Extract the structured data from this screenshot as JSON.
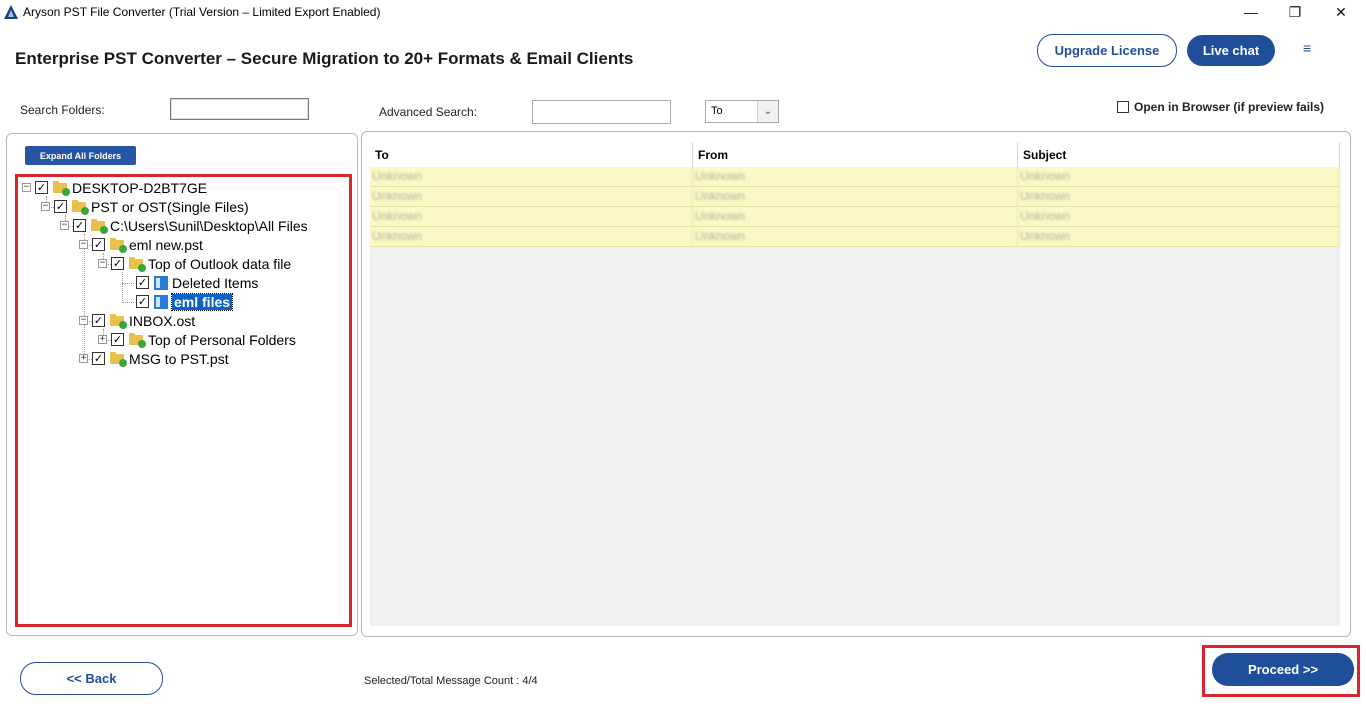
{
  "window": {
    "title": "Aryson PST File Converter (Trial Version – Limited Export Enabled)",
    "controls": {
      "minimize": "—",
      "restore": "❐",
      "close": "✕"
    }
  },
  "header": {
    "heading": "Enterprise PST Converter – Secure Migration to 20+ Formats & Email Clients",
    "upgrade_label": "Upgrade License",
    "livechat_label": "Live chat",
    "menu_icon": "≡"
  },
  "search": {
    "folders_label": "Search Folders:",
    "folders_value": "",
    "advanced_label": "Advanced Search:",
    "advanced_value": "",
    "field_select": "To",
    "open_browser_label": "Open in Browser (if preview fails)"
  },
  "tree": {
    "expand_all_label": "Expand All Folders",
    "nodes": [
      {
        "label": "DESKTOP-D2BT7GE",
        "expander": "−",
        "checked": true,
        "icon": "folder-icon"
      },
      {
        "label": "PST or OST(Single Files)",
        "expander": "−",
        "checked": true,
        "icon": "folder-icon"
      },
      {
        "label": "C:\\Users\\Sunil\\Desktop\\All Files",
        "expander": "−",
        "checked": true,
        "icon": "folder-icon"
      },
      {
        "label": "eml new.pst",
        "expander": "−",
        "checked": true,
        "icon": "folder-icon"
      },
      {
        "label": "Top of Outlook data file",
        "expander": "−",
        "checked": true,
        "icon": "folder-icon"
      },
      {
        "label": "Deleted Items",
        "expander": "",
        "checked": true,
        "icon": "mail-folder-icon"
      },
      {
        "label": "eml files",
        "expander": "",
        "checked": true,
        "icon": "mail-folder-icon",
        "selected": true
      },
      {
        "label": "INBOX.ost",
        "expander": "−",
        "checked": true,
        "icon": "folder-icon"
      },
      {
        "label": "Top of Personal Folders",
        "expander": "+",
        "checked": true,
        "icon": "folder-icon"
      },
      {
        "label": "MSG to PST.pst",
        "expander": "+",
        "checked": true,
        "icon": "folder-icon"
      }
    ]
  },
  "grid": {
    "columns": [
      "To",
      "From",
      "Subject"
    ],
    "rows": [
      [
        "Unknown",
        "Unknown",
        "Unknown"
      ],
      [
        "Unknown",
        "Unknown",
        "Unknown"
      ],
      [
        "Unknown",
        "Unknown",
        "Unknown"
      ],
      [
        "Unknown",
        "Unknown",
        "Unknown"
      ]
    ]
  },
  "footer": {
    "back_label": "<< Back",
    "count_label": "Selected/Total Message Count : 4/4",
    "proceed_label": "Proceed >>"
  },
  "colors": {
    "brand": "#1f4e9b",
    "highlight_box": "#d6262e",
    "row_fill": "#fbf8c6"
  }
}
